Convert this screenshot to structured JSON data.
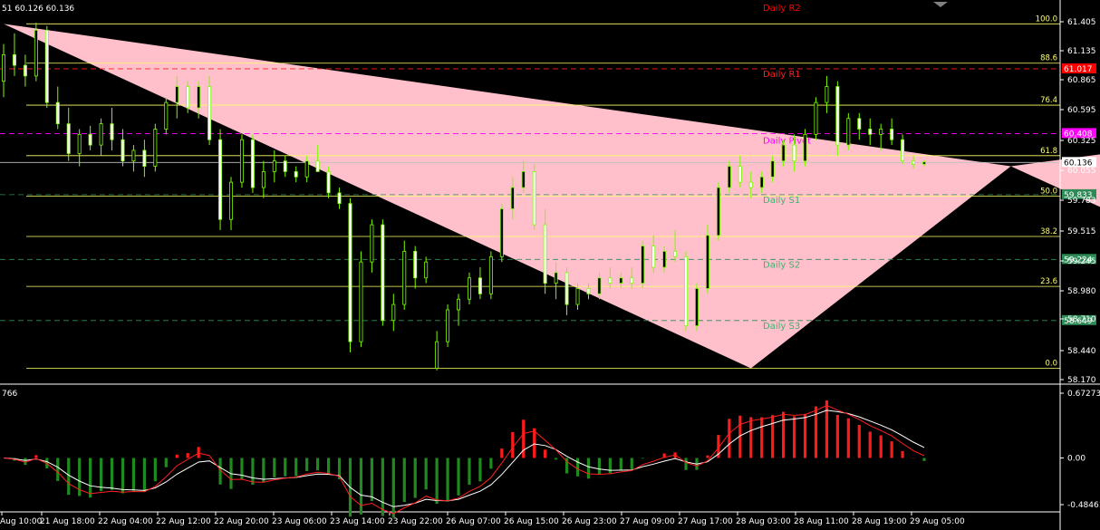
{
  "header": {
    "text": "51 60.126 60.136"
  },
  "indicator": {
    "label": "766"
  },
  "chart_data": [
    {
      "type": "candlestick",
      "ylim": [
        58.17,
        61.43
      ],
      "y_ticks": [
        "61.405",
        "61.135",
        "60.865",
        "60.595",
        "60.325",
        "60.055",
        "59.783",
        "59.515",
        "59.245",
        "58.980",
        "58.710",
        "58.440",
        "58.170"
      ],
      "x_ticks": [
        "Aug 10:00",
        "21 Aug 18:00",
        "22 Aug 04:00",
        "22 Aug 12:00",
        "22 Aug 20:00",
        "23 Aug 06:00",
        "23 Aug 14:00",
        "23 Aug 22:00",
        "26 Aug 07:00",
        "26 Aug 15:00",
        "26 Aug 23:00",
        "27 Aug 09:00",
        "27 Aug 17:00",
        "28 Aug 03:00",
        "28 Aug 11:00",
        "28 Aug 19:00",
        "29 Aug 05:00"
      ],
      "current_price": "60.136",
      "colors": {
        "bull_body": "#000000",
        "bull_outline": "#7cfc00",
        "bear_body": "#ffffff",
        "fib": "#ffff66",
        "harmonic": "#ffc0cb"
      },
      "harmonic_pattern": [
        {
          "x": 0,
          "price": 61.44
        },
        {
          "x": 69,
          "price": 58.2
        },
        {
          "x": 93,
          "price": 60.1
        },
        {
          "x": 127,
          "price": 58.52
        },
        {
          "x": 154,
          "price": 60.93
        }
      ],
      "fib_levels": [
        {
          "label": "100.0",
          "price": 61.44
        },
        {
          "label": "88.6",
          "price": 61.07
        },
        {
          "label": "76.4",
          "price": 60.675
        },
        {
          "label": "61.8",
          "price": 60.2
        },
        {
          "label": "50.0",
          "price": 59.82
        },
        {
          "label": "38.2",
          "price": 59.44
        },
        {
          "label": "23.6",
          "price": 58.97
        },
        {
          "label": "0.0",
          "price": 58.2
        }
      ],
      "pivot_levels": [
        {
          "name": "Daily R2",
          "tag": "",
          "price": 61.48,
          "color": "#ff0000",
          "tag_color": ""
        },
        {
          "name": "Daily R1",
          "tag": "61.017",
          "price": 61.017,
          "color": "#ff2020",
          "tag_color": "#ff0000"
        },
        {
          "name": "Daily Pivot",
          "tag": "60.408",
          "price": 60.408,
          "color": "#ff00ff",
          "tag_color": "#ff00ff"
        },
        {
          "name": "Daily S1",
          "tag": "59.833",
          "price": 59.833,
          "color": "#2e8b57",
          "tag_color": "#2e8b57"
        },
        {
          "name": "Daily S2",
          "tag": "59.224",
          "price": 59.224,
          "color": "#2e8b57",
          "tag_color": "#2e8b57"
        },
        {
          "name": "Daily S3",
          "tag": "58.649",
          "price": 58.649,
          "color": "#2e8b57",
          "tag_color": "#2e8b57"
        }
      ],
      "ohlc": [
        [
          60.9,
          61.25,
          60.75,
          61.15
        ],
        [
          61.15,
          61.35,
          60.95,
          61.05
        ],
        [
          61.05,
          61.15,
          60.85,
          60.95
        ],
        [
          60.95,
          61.45,
          60.9,
          61.38
        ],
        [
          61.38,
          61.42,
          60.65,
          60.7
        ],
        [
          60.7,
          60.85,
          60.45,
          60.5
        ],
        [
          60.5,
          60.65,
          60.15,
          60.22
        ],
        [
          60.22,
          60.45,
          60.1,
          60.4
        ],
        [
          60.4,
          60.48,
          60.25,
          60.3
        ],
        [
          60.3,
          60.55,
          60.2,
          60.5
        ],
        [
          60.5,
          60.65,
          60.25,
          60.35
        ],
        [
          60.35,
          60.45,
          60.1,
          60.15
        ],
        [
          60.15,
          60.3,
          60.05,
          60.25
        ],
        [
          60.25,
          60.35,
          60.0,
          60.1
        ],
        [
          60.1,
          60.5,
          60.05,
          60.45
        ],
        [
          60.45,
          60.75,
          60.4,
          60.7
        ],
        [
          60.7,
          60.95,
          60.55,
          60.85
        ],
        [
          60.85,
          60.9,
          60.6,
          60.65
        ],
        [
          60.65,
          60.9,
          60.55,
          60.85
        ],
        [
          60.85,
          60.95,
          60.3,
          60.35
        ],
        [
          60.35,
          60.45,
          59.5,
          59.6
        ],
        [
          59.6,
          60.0,
          59.5,
          59.95
        ],
        [
          59.95,
          60.4,
          59.9,
          60.35
        ],
        [
          60.35,
          60.4,
          59.85,
          59.9
        ],
        [
          59.9,
          60.15,
          59.8,
          60.05
        ],
        [
          60.05,
          60.25,
          59.95,
          60.15
        ],
        [
          60.15,
          60.2,
          60.0,
          60.05
        ],
        [
          60.05,
          60.1,
          59.95,
          60.0
        ],
        [
          60.0,
          60.2,
          59.95,
          60.15
        ],
        [
          60.15,
          60.3,
          60.05,
          60.05
        ],
        [
          60.05,
          60.1,
          59.8,
          59.85
        ],
        [
          59.85,
          59.9,
          59.7,
          59.75
        ],
        [
          59.75,
          59.8,
          58.35,
          58.45
        ],
        [
          58.45,
          59.3,
          58.4,
          59.2
        ],
        [
          59.2,
          59.6,
          59.1,
          59.55
        ],
        [
          59.55,
          59.6,
          58.6,
          58.65
        ],
        [
          58.65,
          58.9,
          58.55,
          58.8
        ],
        [
          58.8,
          59.4,
          58.75,
          59.3
        ],
        [
          59.3,
          59.35,
          58.95,
          59.05
        ],
        [
          59.05,
          59.25,
          59.0,
          59.2
        ],
        [
          58.2,
          58.55,
          58.18,
          58.45
        ],
        [
          58.45,
          58.8,
          58.4,
          58.75
        ],
        [
          58.75,
          58.9,
          58.6,
          58.85
        ],
        [
          58.85,
          59.1,
          58.8,
          59.05
        ],
        [
          59.05,
          59.15,
          58.85,
          58.9
        ],
        [
          58.9,
          59.3,
          58.85,
          59.25
        ],
        [
          59.25,
          59.75,
          59.2,
          59.7
        ],
        [
          59.7,
          60.0,
          59.6,
          59.9
        ],
        [
          59.9,
          60.15,
          59.85,
          60.05
        ],
        [
          60.05,
          60.12,
          59.5,
          59.55
        ],
        [
          59.55,
          59.7,
          58.9,
          59.0
        ],
        [
          59.0,
          59.2,
          58.85,
          59.1
        ],
        [
          59.1,
          59.15,
          58.7,
          58.8
        ],
        [
          58.8,
          59.0,
          58.75,
          58.95
        ],
        [
          58.95,
          59.0,
          58.85,
          58.9
        ],
        [
          58.9,
          59.1,
          58.85,
          59.05
        ],
        [
          59.05,
          59.15,
          58.95,
          59.0
        ],
        [
          59.0,
          59.1,
          58.95,
          59.05
        ],
        [
          59.05,
          59.15,
          58.95,
          59.0
        ],
        [
          59.0,
          59.4,
          58.95,
          59.35
        ],
        [
          59.35,
          59.45,
          59.1,
          59.15
        ],
        [
          59.15,
          59.35,
          59.1,
          59.3
        ],
        [
          59.3,
          59.5,
          59.2,
          59.25
        ],
        [
          59.25,
          59.3,
          58.55,
          58.6
        ],
        [
          58.6,
          59.0,
          58.55,
          58.95
        ],
        [
          58.95,
          59.55,
          58.9,
          59.45
        ],
        [
          59.45,
          59.95,
          59.4,
          59.9
        ],
        [
          59.9,
          60.15,
          59.85,
          60.1
        ],
        [
          60.1,
          60.2,
          59.9,
          59.95
        ],
        [
          59.95,
          60.05,
          59.8,
          59.9
        ],
        [
          59.9,
          60.05,
          59.85,
          60.0
        ],
        [
          60.0,
          60.2,
          59.95,
          60.15
        ],
        [
          60.15,
          60.35,
          60.1,
          60.3
        ],
        [
          60.3,
          60.4,
          60.05,
          60.15
        ],
        [
          60.15,
          60.45,
          60.1,
          60.4
        ],
        [
          60.4,
          60.75,
          60.35,
          60.7
        ],
        [
          60.7,
          60.95,
          60.6,
          60.85
        ],
        [
          60.85,
          60.9,
          60.2,
          60.3
        ],
        [
          60.3,
          60.6,
          60.25,
          60.55
        ],
        [
          60.55,
          60.6,
          60.35,
          60.45
        ],
        [
          60.45,
          60.55,
          60.3,
          60.4
        ],
        [
          60.4,
          60.5,
          60.25,
          60.45
        ],
        [
          60.45,
          60.55,
          60.3,
          60.35
        ],
        [
          60.35,
          60.4,
          60.12,
          60.15
        ],
        [
          60.15,
          60.2,
          60.08,
          60.12
        ],
        [
          60.12,
          60.16,
          60.1,
          60.14
        ]
      ],
      "indicator_ylim": [
        -0.48461,
        0.67273
      ],
      "indicator_ticks": [
        "0.67273",
        "0.00",
        "-0.48461"
      ],
      "histogram_color_up": "#ff1a1a",
      "histogram_color_down": "#1f8b1f",
      "signal_color": "#ffffff",
      "main_color": "#ff2020"
    }
  ]
}
